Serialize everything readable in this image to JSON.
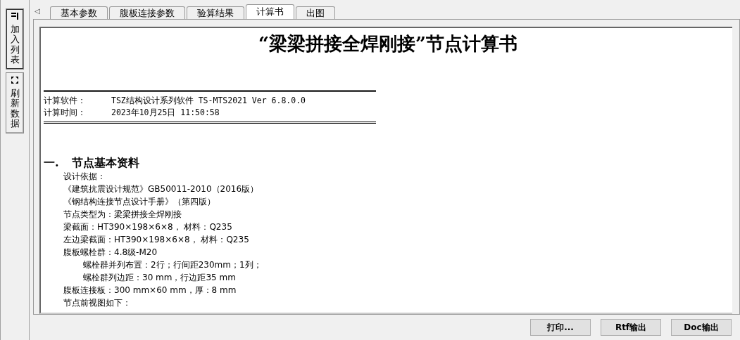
{
  "side_buttons": [
    {
      "kind": "list",
      "label": "加入列表"
    },
    {
      "kind": "refresh",
      "label": "刷新数据"
    }
  ],
  "tabs_scroll": "◁",
  "tabs": [
    {
      "label": "基本参数",
      "selected": false
    },
    {
      "label": "腹板连接参数",
      "selected": false
    },
    {
      "label": "验算结果",
      "selected": false
    },
    {
      "label": "计算书",
      "selected": true
    },
    {
      "label": "出图",
      "selected": false
    }
  ],
  "document": {
    "title": "“梁梁拼接全焊刚接”节点计算书",
    "info": [
      {
        "label": "计算软件：",
        "value": "TSZ结构设计系列软件 TS-MTS2021 Ver 6.8.0.0"
      },
      {
        "label": "计算时间：",
        "value": "2023年10月25日 11:50:58"
      }
    ],
    "section": {
      "number": "一.",
      "title": "节点基本资料"
    },
    "lines": [
      {
        "text": "设计依据："
      },
      {
        "text": "《建筑抗震设计规范》GB50011-2010（2016版）"
      },
      {
        "text": "《钢结构连接节点设计手册》（第四版）"
      },
      {
        "text": "节点类型为：梁梁拼接全焊刚接"
      },
      {
        "text": "梁截面：HT390×198×6×8， 材料：Q235"
      },
      {
        "text": "左边梁截面：HT390×198×6×8， 材料：Q235"
      },
      {
        "text": "腹板螺栓群：4.8级-M20",
        "children": [
          {
            "text": "螺栓群并列布置：2行；行间距230mm；1列；"
          },
          {
            "text": "螺栓群列边距：30 mm，行边距35 mm"
          }
        ]
      },
      {
        "text": "腹板连接板：300 mm×60 mm，厚：8 mm"
      },
      {
        "text": "节点前视图如下："
      }
    ]
  },
  "buttons": [
    "打印...",
    "Rtf输出",
    "Doc输出"
  ]
}
